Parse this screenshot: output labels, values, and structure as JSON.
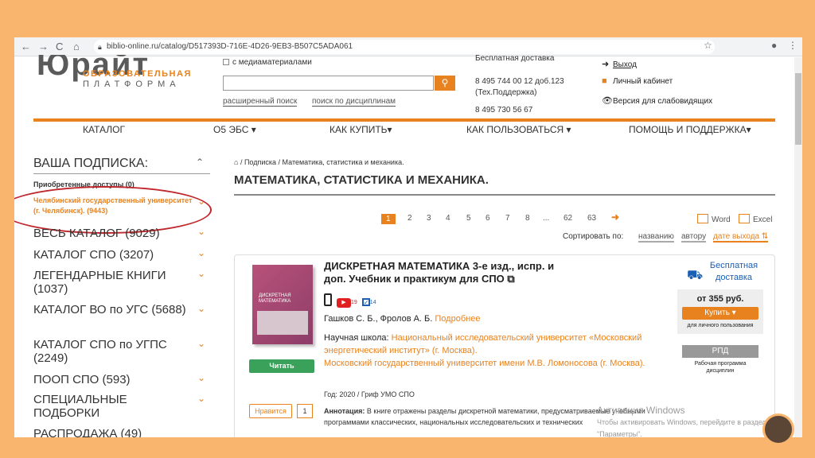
{
  "browser": {
    "back": "←",
    "forward": "→",
    "reload": "C",
    "home": "⌂",
    "url": "biblio-online.ru/catalog/D517393D-716E-4D26-9EB3-B507C5ADA061",
    "star_icon": "☆",
    "menu_icon": "⋮",
    "profile_icon": "●"
  },
  "header": {
    "logo_mark": "Юрайт",
    "logo_line1": "ОБРАЗОВАТЕЛЬНАЯ",
    "logo_line2": "ПЛАТФОРМА",
    "media_checkbox_label": "с медиаматериалами",
    "search_placeholder": "",
    "adv_search": "расширенный поиск",
    "search_by_disc": "поиск по дисциплинам",
    "free_delivery": "Бесплатная доставка",
    "phone1": "8 495 744 00 12 доб.123",
    "phone1_note": "(Тех.Поддержка)",
    "phone2": "8 495 730 56 67",
    "exit": "Выход",
    "cabinet": "Личный кабинет",
    "low_vision": "Версия для слабовидящих"
  },
  "nav": [
    "КАТАЛОГ",
    "О5 ЭБС ▾",
    "КАК КУПИТЬ▾",
    "КАК ПОЛЬЗОВАТЬСЯ ▾",
    "ПОМОЩЬ И ПОДДЕРЖКА▾"
  ],
  "sidebar": {
    "title": "ВАША ПОДПИСКА:",
    "acquired": "Приобретенные доступы (0)",
    "university": "Челябинский государственный университет (г. Челябинск). (9443)",
    "items": [
      {
        "label": "ВЕСЬ КАТАЛОГ (9029)"
      },
      {
        "label": "КАТАЛОГ СПО (3207)"
      },
      {
        "label": "ЛЕГЕНДАРНЫЕ КНИГИ (1037)"
      },
      {
        "label": "КАТАЛОГ ВО по УГС (5688)"
      },
      {
        "label": "КАТАЛОГ СПО по УГПС (2249)"
      },
      {
        "label": "ПООП СПО (593)"
      },
      {
        "label": "СПЕЦИАЛЬНЫЕ ПОДБОРКИ"
      },
      {
        "label": "РАСПРОДАЖА (49)"
      }
    ]
  },
  "main": {
    "breadcrumb_1": "Подписка",
    "breadcrumb_2": "Математика, статистика и механика.",
    "title": "МАТЕМАТИКА, СТАТИСТИКА И МЕХАНИКА.",
    "pages": [
      "1",
      "2",
      "3",
      "4",
      "5",
      "6",
      "7",
      "8",
      "...",
      "62",
      "63"
    ],
    "export_word": "Word",
    "export_excel": "Excel",
    "sort_label": "Сортировать по:",
    "sort_name": "названию",
    "sort_author": "автору",
    "sort_date": "дате выхода"
  },
  "book": {
    "cover_title": "ДИСКРЕТНАЯ МАТЕМАТИКА",
    "title": "ДИСКРЕТНАЯ МАТЕМАТИКА 3-е изд., испр. и доп. Учебник и практикум для СПО",
    "video_count": "19",
    "test_count": "14",
    "authors": "Гашков С. Б., Фролов А. Б.",
    "more": "Подробнее",
    "school_label": "Научная школа:",
    "school_1": "Национальный исследовательский университет «Московский энергетический институт» (г. Москва).",
    "school_2": "Московский государственный университет имени М.В. Ломоносова (г. Москва).",
    "meta": "Год: 2020 / Гриф УМО СПО",
    "annot_label": "Аннотация:",
    "annot": "В книге отражены разделы дискретной математики, предусматриваемые учебными программами классических, национальных исследовательских и технических",
    "read": "Читать",
    "preview": "Нравится",
    "likes": "1",
    "free_ship": "Бесплатная доставка",
    "price": "от 355 руб.",
    "buy": "Купить ▾",
    "buy_note": "для личного пользования",
    "rpd": "РПД",
    "rpd_note": "Рабочая программа дисциплин"
  },
  "watermark": {
    "line1": "Активация Windows",
    "line2": "Чтобы активировать Windows, перейдите в раздел \"Параметры\"."
  }
}
